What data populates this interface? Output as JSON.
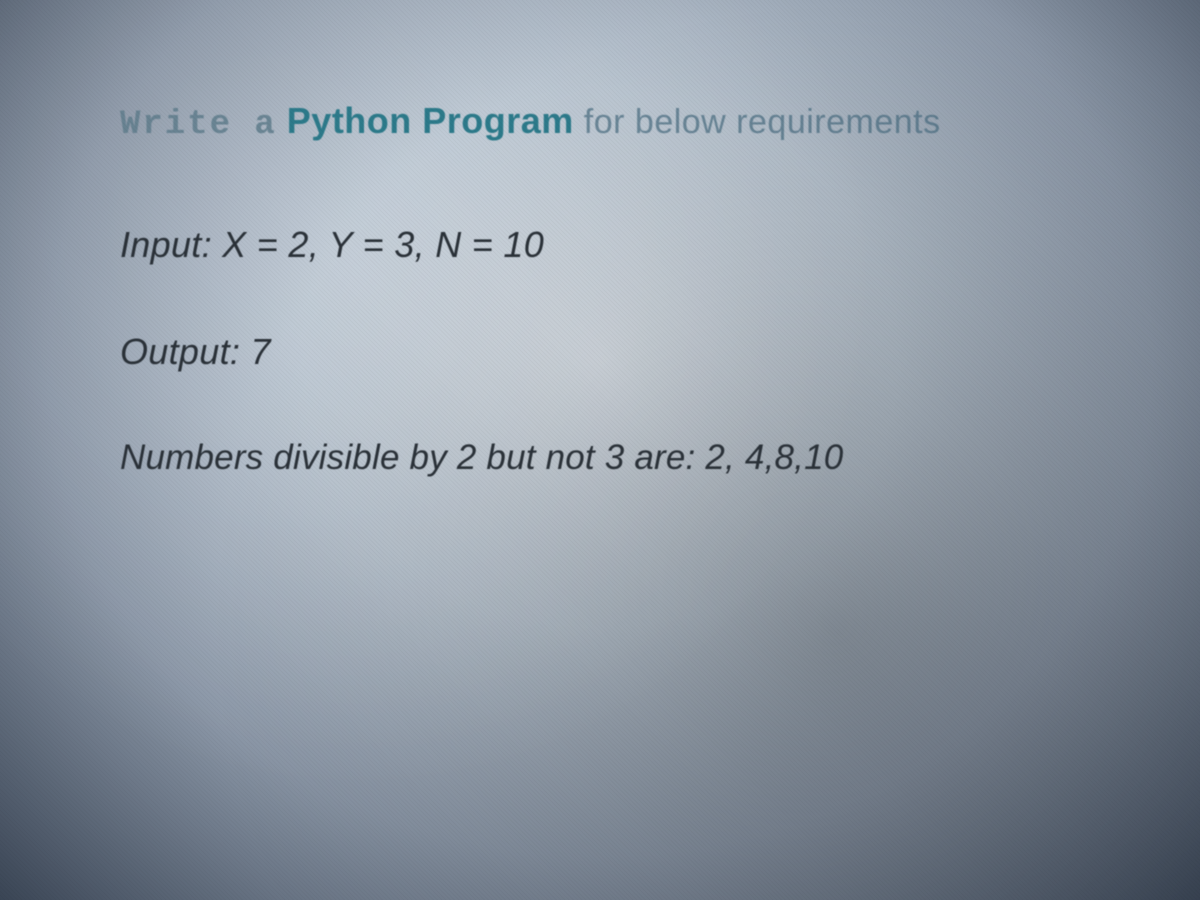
{
  "heading": {
    "write_a": "Write a",
    "python_program": "Python Program",
    "requirements": "for below requirements"
  },
  "lines": {
    "input": "Input: X = 2, Y = 3, N = 10",
    "output": "Output: 7",
    "explanation": "Numbers divisible by 2 but not 3 are: 2, 4,8,10"
  }
}
